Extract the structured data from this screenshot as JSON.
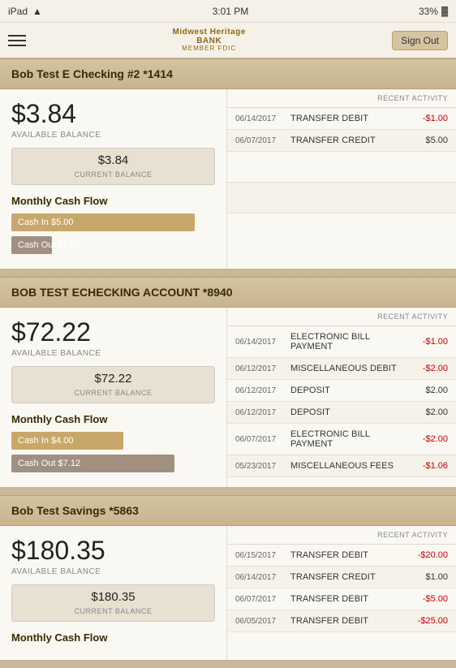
{
  "statusBar": {
    "carrier": "iPad",
    "wifi": "wifi",
    "time": "3:01 PM",
    "battery": "33%"
  },
  "nav": {
    "bankNameLine1": "Midwest Heritage",
    "bankNameLine2": "BANK",
    "bankNameSub": "MEMBER FDIC",
    "signOutLabel": "Sign Out"
  },
  "accounts": [
    {
      "id": "checking1",
      "title": "Bob Test E Checking #2 *1414",
      "availableBalance": "$3.84",
      "availableLabel": "AVAILABLE BALANCE",
      "currentBalance": "$3.84",
      "currentLabel": "CURRENT BALANCE",
      "cashFlowTitle": "Monthly Cash Flow",
      "cashIn": {
        "label": "Cash In $5.00",
        "widthPct": 90
      },
      "cashOut": {
        "label": "Cash Out $1.00",
        "widthPct": 20
      },
      "recentActivityHeader": "RECENT ACTIVITY",
      "activities": [
        {
          "date": "06/14/2017",
          "desc": "TRANSFER DEBIT",
          "amount": "-$1.00",
          "type": "negative"
        },
        {
          "date": "06/07/2017",
          "desc": "TRANSFER CREDIT",
          "amount": "$5.00",
          "type": "positive"
        }
      ],
      "emptyRows": 2
    },
    {
      "id": "checking2",
      "title": "BOB TEST ECHECKING ACCOUNT *8940",
      "availableBalance": "$72.22",
      "availableLabel": "AVAILABLE BALANCE",
      "currentBalance": "$72.22",
      "currentLabel": "CURRENT BALANCE",
      "cashFlowTitle": "Monthly Cash Flow",
      "cashIn": {
        "label": "Cash In $4.00",
        "widthPct": 55
      },
      "cashOut": {
        "label": "Cash Out $7.12",
        "widthPct": 80
      },
      "recentActivityHeader": "RECENT ACTIVITY",
      "activities": [
        {
          "date": "06/14/2017",
          "desc": "ELECTRONIC BILL PAYMENT",
          "amount": "-$1.00",
          "type": "negative"
        },
        {
          "date": "06/12/2017",
          "desc": "MISCELLANEOUS DEBIT",
          "amount": "-$2.00",
          "type": "negative"
        },
        {
          "date": "06/12/2017",
          "desc": "DEPOSIT",
          "amount": "$2.00",
          "type": "positive"
        },
        {
          "date": "06/12/2017",
          "desc": "DEPOSIT",
          "amount": "$2.00",
          "type": "positive"
        },
        {
          "date": "06/07/2017",
          "desc": "ELECTRONIC BILL PAYMENT",
          "amount": "-$2.00",
          "type": "negative"
        },
        {
          "date": "05/23/2017",
          "desc": "MISCELLANEOUS FEES",
          "amount": "-$1.06",
          "type": "negative"
        }
      ],
      "emptyRows": 0
    },
    {
      "id": "savings",
      "title": "Bob Test Savings *5863",
      "availableBalance": "$180.35",
      "availableLabel": "AVAILABLE BALANCE",
      "currentBalance": "$180.35",
      "currentLabel": "CURRENT BALANCE",
      "cashFlowTitle": "Monthly Cash Flow",
      "cashIn": {
        "label": "",
        "widthPct": 0
      },
      "cashOut": {
        "label": "",
        "widthPct": 0
      },
      "recentActivityHeader": "RECENT ACTIVITY",
      "activities": [
        {
          "date": "06/15/2017",
          "desc": "TRANSFER DEBIT",
          "amount": "-$20.00",
          "type": "negative"
        },
        {
          "date": "06/14/2017",
          "desc": "TRANSFER CREDIT",
          "amount": "$1.00",
          "type": "positive"
        },
        {
          "date": "06/07/2017",
          "desc": "TRANSFER DEBIT",
          "amount": "-$5.00",
          "type": "negative"
        },
        {
          "date": "06/05/2017",
          "desc": "TRANSFER DEBIT",
          "amount": "-$25.00",
          "type": "negative"
        }
      ],
      "emptyRows": 0
    }
  ]
}
